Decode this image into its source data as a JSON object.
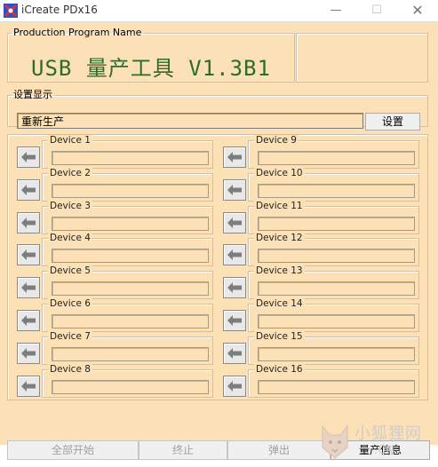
{
  "window": {
    "title": "iCreate PDx16",
    "min_glyph": "—",
    "max_glyph": "☐",
    "close_glyph": "✕"
  },
  "production": {
    "legend": "Production Program Name",
    "title": "USB 量产工具 V1.3B1"
  },
  "setting": {
    "legend": "设置显示",
    "value": "重新生产",
    "button": "设置"
  },
  "devices": [
    {
      "label": "Device 1"
    },
    {
      "label": "Device 2"
    },
    {
      "label": "Device 3"
    },
    {
      "label": "Device 4"
    },
    {
      "label": "Device 5"
    },
    {
      "label": "Device 6"
    },
    {
      "label": "Device 7"
    },
    {
      "label": "Device 8"
    },
    {
      "label": "Device 9"
    },
    {
      "label": "Device 10"
    },
    {
      "label": "Device 11"
    },
    {
      "label": "Device 12"
    },
    {
      "label": "Device 13"
    },
    {
      "label": "Device 14"
    },
    {
      "label": "Device 15"
    },
    {
      "label": "Device 16"
    }
  ],
  "bottom_buttons": {
    "start_all": "全部开始",
    "stop": "终止",
    "eject": "弹出",
    "info": "量产信息"
  },
  "watermark": {
    "text": "小狐狸网",
    "sub": ".CN"
  },
  "colors": {
    "panel": "#fbe1b5",
    "title_green": "#2f6a30"
  }
}
